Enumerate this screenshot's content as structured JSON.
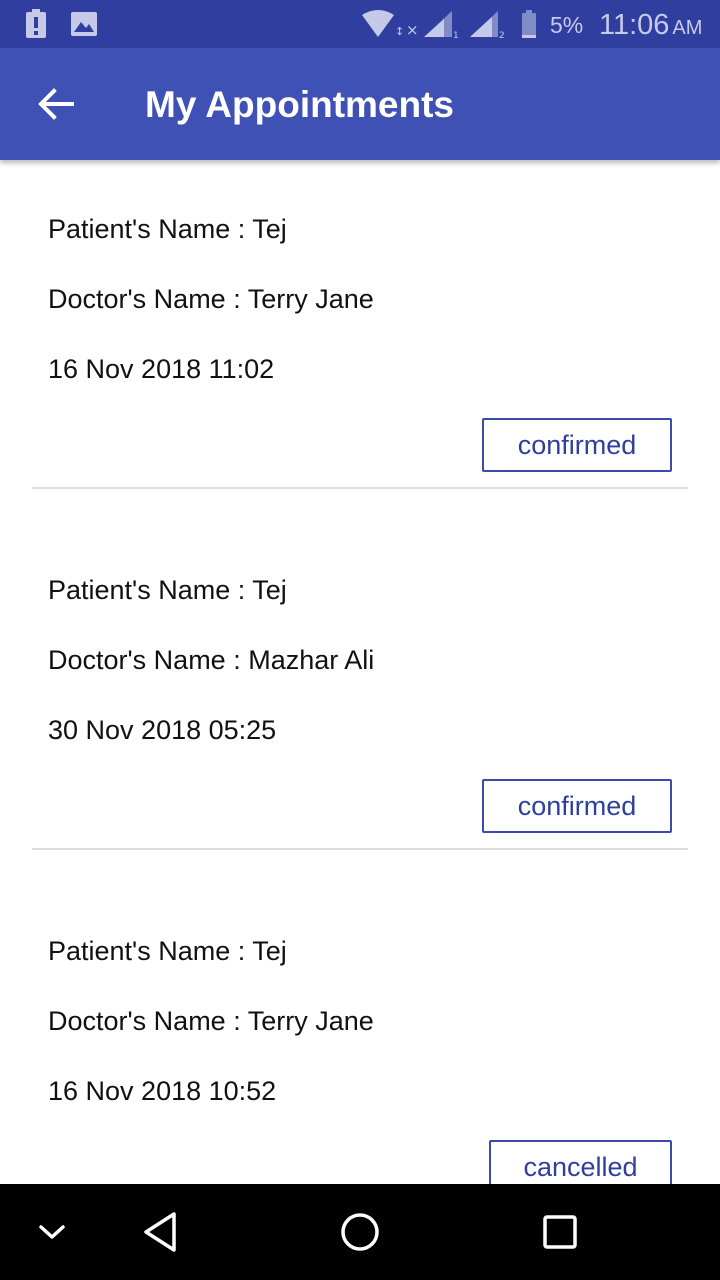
{
  "status_bar": {
    "battery_percent": "5%",
    "time": "11:06",
    "ampm": "AM",
    "icons": [
      "battery-alert-icon",
      "image-icon",
      "wifi-icon",
      "signal-sim1-icon",
      "signal-sim2-icon",
      "battery-icon"
    ]
  },
  "app_bar": {
    "title": "My Appointments",
    "back_icon": "arrow-left-icon",
    "background_color": "#3f51b5"
  },
  "appointments": [
    {
      "patient": "Patient's Name : Tej",
      "doctor": "Doctor's Name : Terry Jane",
      "datetime": "16 Nov 2018 11:02",
      "status": "confirmed"
    },
    {
      "patient": "Patient's Name : Tej",
      "doctor": "Doctor's Name : Mazhar Ali",
      "datetime": "30 Nov 2018 05:25",
      "status": "confirmed"
    },
    {
      "patient": "Patient's Name : Tej",
      "doctor": "Doctor's Name : Terry Jane",
      "datetime": "16 Nov 2018 10:52",
      "status": "cancelled"
    }
  ],
  "nav_bar": {
    "buttons": [
      "chevron-down-icon",
      "back-triangle-icon",
      "home-circle-icon",
      "recents-square-icon"
    ]
  },
  "colors": {
    "status_bar": "#303f9f",
    "accent": "#3a4ba8"
  }
}
